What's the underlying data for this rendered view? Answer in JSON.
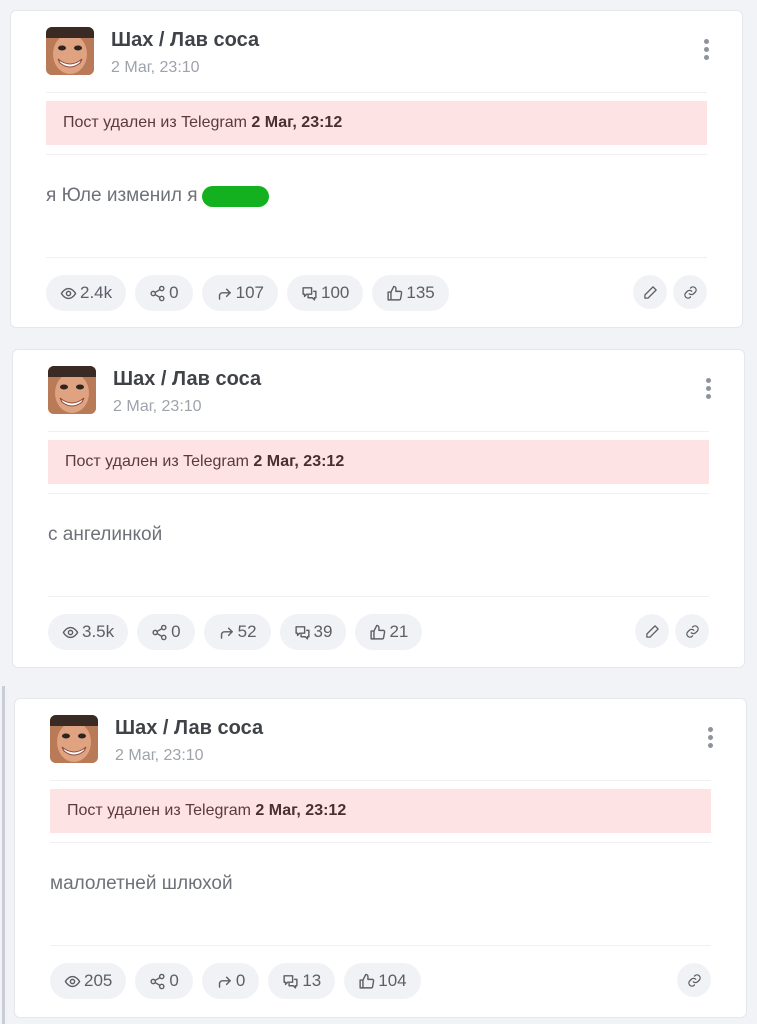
{
  "posts": [
    {
      "author": "Шах / Лав соса",
      "date": "2 Маг, 23:10",
      "deleted_prefix": "Пост удален из Telegram",
      "deleted_time": "2 Маг, 23:12",
      "text": "я Юле изменил я",
      "has_highlight": true,
      "highlight_color": "#13b11f",
      "stats": {
        "views": "2.4k",
        "shares": "0",
        "forwards": "107",
        "comments": "100",
        "likes": "135"
      },
      "has_edit": true
    },
    {
      "author": "Шах / Лав соса",
      "date": "2 Маг, 23:10",
      "deleted_prefix": "Пост удален из Telegram",
      "deleted_time": "2 Маг, 23:12",
      "text": "с ангелинкой",
      "has_highlight": false,
      "stats": {
        "views": "3.5k",
        "shares": "0",
        "forwards": "52",
        "comments": "39",
        "likes": "21"
      },
      "has_edit": true
    },
    {
      "author": "Шах / Лав соса",
      "date": "2 Маг, 23:10",
      "deleted_prefix": "Пост удален из Telegram",
      "deleted_time": "2 Маг, 23:12",
      "text": "малолетней шлюхой",
      "has_highlight": false,
      "stats": {
        "views": "205",
        "shares": "0",
        "forwards": "0",
        "comments": "13",
        "likes": "104"
      },
      "has_edit": false
    }
  ],
  "colors": {
    "deleted_banner": "#fde3e3",
    "pill_bg": "#f0f2f6",
    "page_bg": "#f1f3f7"
  },
  "icons": [
    "avatar",
    "more-vertical-icon",
    "eye-icon",
    "share-nodes-icon",
    "forward-arrow-icon",
    "comments-icon",
    "thumbs-up-icon",
    "pencil-icon",
    "link-icon"
  ]
}
